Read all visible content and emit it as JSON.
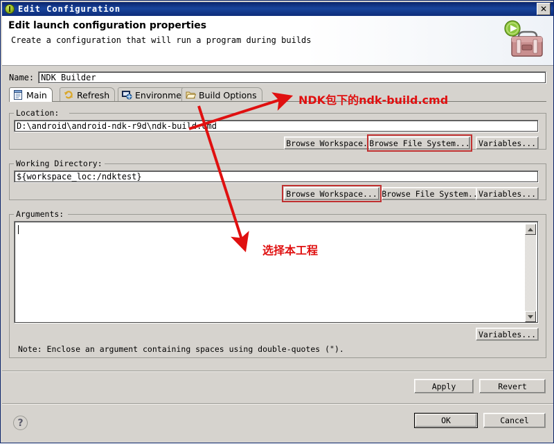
{
  "window": {
    "title": "Edit Configuration",
    "icon": "launch-config-icon",
    "close_label": "✕"
  },
  "header": {
    "title": "Edit launch configuration properties",
    "subtitle": "Create a configuration that will run a program during builds",
    "art_icon": "toolbox-with-run-icon"
  },
  "name_field": {
    "label": "Name:",
    "value": "NDK Builder"
  },
  "tabs": [
    {
      "label": "Main",
      "icon": "main-tab-icon",
      "selected": true
    },
    {
      "label": "Refresh",
      "icon": "refresh-tab-icon",
      "selected": false
    },
    {
      "label": "Environment",
      "icon": "environment-tab-icon",
      "selected": false
    },
    {
      "label": "Build Options",
      "icon": "folder-tab-icon",
      "selected": false
    }
  ],
  "location": {
    "group_label": "Location:",
    "value": "D:\\android\\android-ndk-r9d\\ndk-build.cmd",
    "buttons": [
      {
        "label": "Browse Workspace...",
        "highlighted": false
      },
      {
        "label": "Browse File System...",
        "highlighted": true
      },
      {
        "label": "Variables...",
        "highlighted": false
      }
    ]
  },
  "working_directory": {
    "group_label": "Working Directory:",
    "value": "${workspace_loc:/ndktest}",
    "buttons": [
      {
        "label": "Browse Workspace...",
        "highlighted": true
      },
      {
        "label": "Browse File System...",
        "highlighted": false
      },
      {
        "label": "Variables...",
        "highlighted": false
      }
    ]
  },
  "arguments": {
    "group_label": "Arguments:",
    "value": "",
    "variables_button": "Variables...",
    "note": "Note: Enclose an argument containing spaces using double-quotes (\")."
  },
  "footer": {
    "apply_label": "Apply",
    "revert_label": "Revert",
    "ok_label": "OK",
    "cancel_label": "Cancel",
    "help_label": "?"
  },
  "annotations": [
    {
      "text": "NDK包下的ndk-build.cmd"
    },
    {
      "text": "选择本工程"
    }
  ],
  "colors": {
    "titlebar": "#0a246a",
    "dialog_face": "#d6d3ce",
    "annotation_red": "#e01010",
    "highlight_box": "#c03030"
  }
}
